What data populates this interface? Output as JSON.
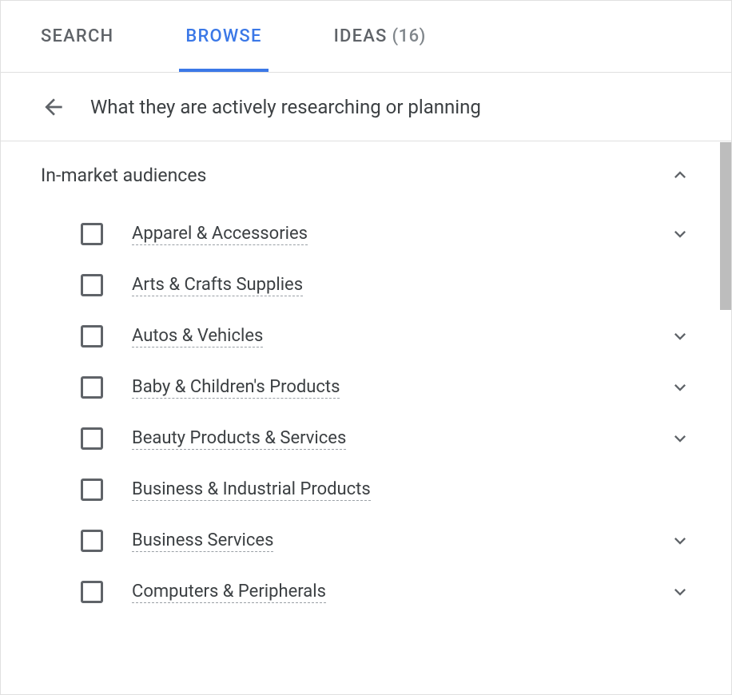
{
  "tabs": {
    "search": "SEARCH",
    "browse": "BROWSE",
    "ideas": "IDEAS",
    "ideas_count": "(16)"
  },
  "breadcrumb": {
    "title": "What they are actively researching or planning"
  },
  "section": {
    "title": "In-market audiences"
  },
  "items": [
    {
      "label": "Apparel & Accessories",
      "expandable": true
    },
    {
      "label": "Arts & Crafts Supplies",
      "expandable": false
    },
    {
      "label": "Autos & Vehicles",
      "expandable": true
    },
    {
      "label": "Baby & Children's Products",
      "expandable": true
    },
    {
      "label": "Beauty Products & Services",
      "expandable": true
    },
    {
      "label": "Business & Industrial Products",
      "expandable": false
    },
    {
      "label": "Business Services",
      "expandable": true
    },
    {
      "label": "Computers & Peripherals",
      "expandable": true
    }
  ]
}
